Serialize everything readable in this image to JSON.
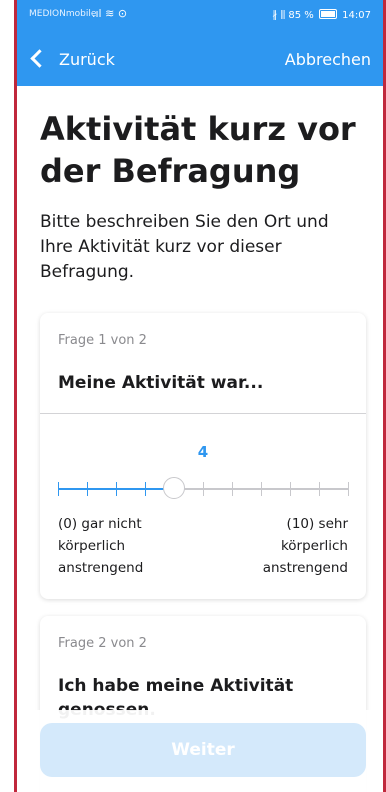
{
  "statusbar": {
    "carrier": "MEDIONmobile",
    "signal_icons": ".ıl ≋ ⊙",
    "right": "∦ ⫼ 85 %",
    "time": "14:07"
  },
  "navbar": {
    "back_label": "Zurück",
    "cancel_label": "Abbrechen"
  },
  "page": {
    "title": "Aktivität kurz vor der Befragung",
    "intro": "Bitte beschreiben Sie den Ort und Ihre Aktivität kurz vor dieser Befragung."
  },
  "questions": [
    {
      "counter": "Frage 1 von 2",
      "text": "Meine Aktivität war...",
      "slider": {
        "value": "4",
        "value_number": 4,
        "min": 0,
        "max": 10,
        "min_label": "(0) gar nicht\nkörperlich\nanstrengend",
        "max_label": "(10) sehr\nkörperlich\nanstrengend"
      }
    },
    {
      "counter": "Frage 2 von 2",
      "text": "Ich habe meine Aktivität genossen."
    }
  ],
  "footer": {
    "next_label": "Weiter"
  },
  "colors": {
    "accent": "#2f97f0",
    "frame_border": "#c0283c",
    "button_disabled": "#d4e9fb"
  }
}
